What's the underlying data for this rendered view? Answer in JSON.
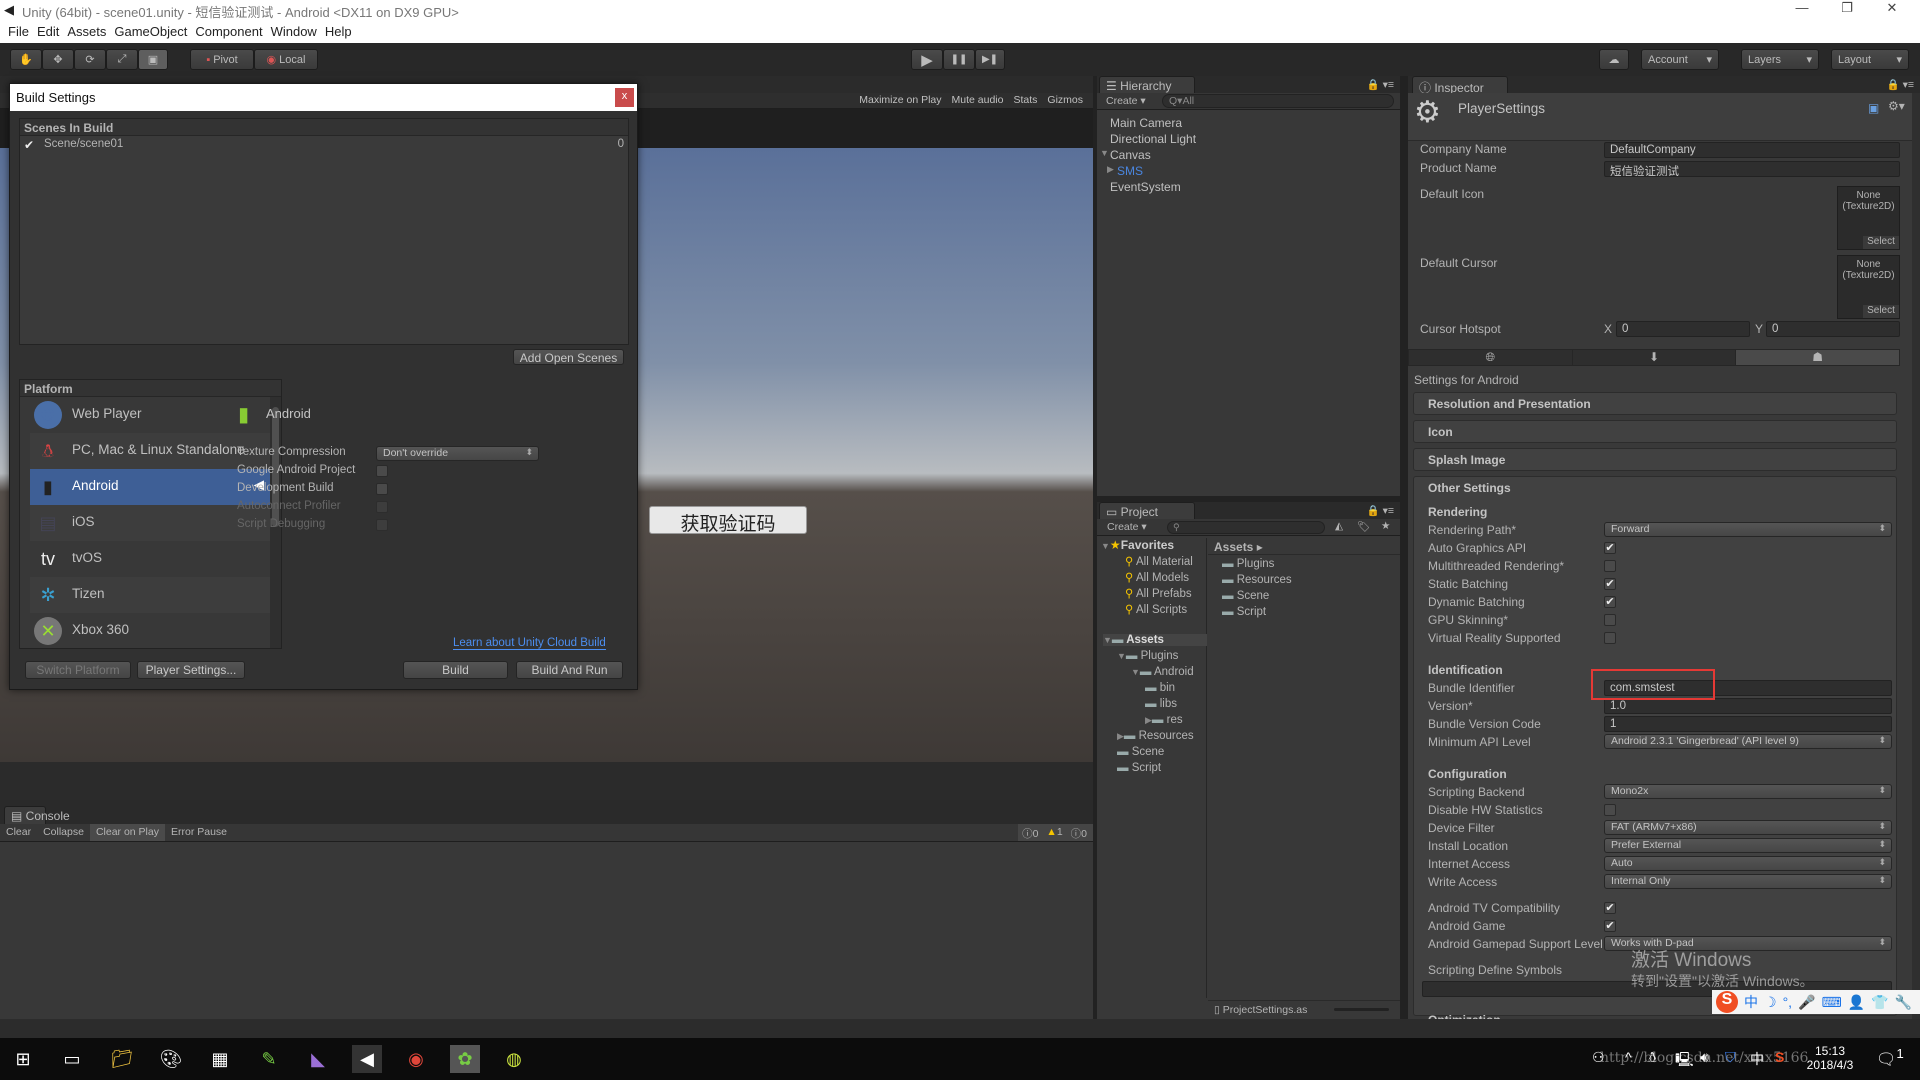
{
  "window": {
    "title": "Unity (64bit) - scene01.unity - 短信验证测试 - Android <DX11 on DX9 GPU>",
    "minimize": "—",
    "maximize": "❐",
    "close": "✕"
  },
  "menu": [
    "File",
    "Edit",
    "Assets",
    "GameObject",
    "Component",
    "Window",
    "Help"
  ],
  "toolbar": {
    "tools": [
      "hand-icon",
      "move-icon",
      "rotate-icon",
      "scale-icon",
      "rect-icon"
    ],
    "active_tool": "rect-icon",
    "pivot": "Pivot",
    "local": "Local",
    "play": "▶",
    "pause": "❚❚",
    "step": "▶❚",
    "account": "Account",
    "layers": "Layers",
    "layout": "Layout"
  },
  "game": {
    "toolbar": [
      "Maximize on Play",
      "Mute audio",
      "Stats",
      "Gizmos"
    ],
    "button_text": "获取验证码",
    "colors": {
      "sky": "#5a7099",
      "horizon": "#b8bcc0",
      "ground": "#564f4a"
    }
  },
  "build_settings": {
    "title": "Build Settings",
    "close": "x",
    "scenes_header": "Scenes In Build",
    "scenes": [
      {
        "name": "Scene/scene01",
        "index": "0",
        "checked": true
      }
    ],
    "add_open_scenes": "Add Open Scenes",
    "platform_header": "Platform",
    "platforms": [
      {
        "name": "Web Player",
        "icon": "globe-icon",
        "color": "#4a6fa8"
      },
      {
        "name": "PC, Mac & Linux Standalone",
        "icon": "standalone-icon",
        "color": "#d44"
      },
      {
        "name": "Android",
        "icon": "android-icon",
        "color": "#222",
        "selected": true,
        "active": true
      },
      {
        "name": "iOS",
        "icon": "ios-icon",
        "color": "#445"
      },
      {
        "name": "tvOS",
        "icon": "tvos-icon",
        "color": "#eee"
      },
      {
        "name": "Tizen",
        "icon": "tizen-icon",
        "color": "#3aa0d0"
      },
      {
        "name": "Xbox 360",
        "icon": "xbox-icon",
        "color": "#777"
      }
    ],
    "selected_platform": "Android",
    "options": [
      {
        "label": "Texture Compression",
        "type": "dropdown",
        "value": "Don't override"
      },
      {
        "label": "Google Android Project",
        "type": "check",
        "checked": false
      },
      {
        "label": "Development Build",
        "type": "check",
        "checked": false
      },
      {
        "label": "Autoconnect Profiler",
        "type": "check",
        "checked": false,
        "disabled": true
      },
      {
        "label": "Script Debugging",
        "type": "check",
        "checked": false,
        "disabled": true
      }
    ],
    "cloud_link": "Learn about Unity Cloud Build",
    "switch_platform": "Switch Platform",
    "player_settings": "Player Settings...",
    "build": "Build",
    "build_and_run": "Build And Run"
  },
  "hierarchy": {
    "tab": "Hierarchy",
    "create": "Create ▾",
    "search_placeholder": "Q▾All",
    "items": [
      {
        "name": "Main Camera"
      },
      {
        "name": "Directional Light"
      },
      {
        "name": "Canvas",
        "expanded": true
      },
      {
        "name": "SMS",
        "child": true,
        "collapsed": true
      },
      {
        "name": "EventSystem"
      }
    ]
  },
  "project": {
    "tab": "Project",
    "create": "Create ▾",
    "favorites_label": "Favorites",
    "favorites": [
      "All Material",
      "All Models",
      "All Prefabs",
      "All Scripts"
    ],
    "tree": [
      {
        "name": "Assets",
        "depth": 0,
        "bold": true
      },
      {
        "name": "Plugins",
        "depth": 1
      },
      {
        "name": "Android",
        "depth": 2
      },
      {
        "name": "bin",
        "depth": 3
      },
      {
        "name": "libs",
        "depth": 3
      },
      {
        "name": "res",
        "depth": 3
      },
      {
        "name": "Resources",
        "depth": 1
      },
      {
        "name": "Scene",
        "depth": 1
      },
      {
        "name": "Script",
        "depth": 1
      }
    ],
    "breadcrumb": "Assets ▸",
    "contents": [
      "Plugins",
      "Resources",
      "Scene",
      "Script"
    ],
    "status_file": "ProjectSettings.as"
  },
  "console": {
    "tab": "Console",
    "buttons": [
      "Clear",
      "Collapse",
      "Clear on Play",
      "Error Pause"
    ],
    "active_button": "Clear on Play",
    "counts": {
      "info": "0",
      "warnings": "1",
      "errors": "0"
    }
  },
  "inspector": {
    "tab": "Inspector",
    "object": "PlayerSettings",
    "company_label": "Company Name",
    "company": "DefaultCompany",
    "product_label": "Product Name",
    "product": "短信验证测试",
    "default_icon_label": "Default Icon",
    "default_cursor_label": "Default Cursor",
    "texture_none": "None",
    "texture_type": "(Texture2D)",
    "select": "Select",
    "hotspot_label": "Cursor Hotspot",
    "hotspot_x_label": "X",
    "hotspot_x": "0",
    "hotspot_y_label": "Y",
    "hotspot_y": "0",
    "platform_tabs": [
      "globe-icon",
      "download-icon",
      "android-icon"
    ],
    "active_platform_tab": "android-icon",
    "settings_for": "Settings for Android",
    "foldouts": [
      "Resolution and Presentation",
      "Icon",
      "Splash Image",
      "Other Settings"
    ],
    "groups": [
      {
        "header": "Rendering",
        "blocks": [
          [
            {
              "label": "Rendering Path*",
              "type": "dropdown",
              "value": "Forward"
            },
            {
              "label": "Auto Graphics API",
              "type": "check",
              "checked": true
            },
            {
              "label": "Multithreaded Rendering*",
              "type": "check",
              "checked": false
            },
            {
              "label": "Static Batching",
              "type": "check",
              "checked": true
            },
            {
              "label": "Dynamic Batching",
              "type": "check",
              "checked": true
            },
            {
              "label": "GPU Skinning*",
              "type": "check",
              "checked": false
            },
            {
              "label": "Virtual Reality Supported",
              "type": "check",
              "checked": false
            }
          ]
        ]
      },
      {
        "header": "Identification",
        "blocks": [
          [
            {
              "label": "Bundle Identifier",
              "type": "text",
              "value": "com.smstest",
              "highlighted": true
            },
            {
              "label": "Version*",
              "type": "text",
              "value": "1.0"
            },
            {
              "label": "Bundle Version Code",
              "type": "text",
              "value": "1"
            },
            {
              "label": "Minimum API Level",
              "type": "dropdown",
              "value": "Android 2.3.1 'Gingerbread' (API level 9)"
            }
          ]
        ]
      },
      {
        "header": "Configuration",
        "blocks": [
          [
            {
              "label": "Scripting Backend",
              "type": "dropdown",
              "value": "Mono2x"
            },
            {
              "label": "Disable HW Statistics",
              "type": "check",
              "checked": false
            },
            {
              "label": "Device Filter",
              "type": "dropdown",
              "value": "FAT (ARMv7+x86)"
            },
            {
              "label": "Install Location",
              "type": "dropdown",
              "value": "Prefer External"
            },
            {
              "label": "Internet Access",
              "type": "dropdown",
              "value": "Auto"
            },
            {
              "label": "Write Access",
              "type": "dropdown",
              "value": "Internal Only"
            }
          ],
          [
            {
              "label": "Android TV Compatibility",
              "type": "check",
              "checked": true
            },
            {
              "label": "Android Game",
              "type": "check",
              "checked": true
            },
            {
              "label": "Android Gamepad Support Level",
              "type": "dropdown",
              "value": "Works with D-pad"
            }
          ],
          [
            {
              "label": "Scripting Define Symbols",
              "type": "label"
            },
            {
              "label": "",
              "type": "widetext",
              "value": ""
            }
          ]
        ]
      },
      {
        "header": "Optimization",
        "blocks": []
      }
    ],
    "highlight_color": "#e53935"
  },
  "watermark": {
    "activate": "激活 Windows",
    "activate_sub": "转到\"设置\"以激活 Windows。",
    "blog": "http://blog.csdn.net/xmx5166"
  },
  "ime": {
    "logo": "S",
    "items": [
      "中",
      "☽",
      "°,",
      "🎤",
      "⌨",
      "👤",
      "👕",
      "🔧"
    ]
  },
  "taskbar": {
    "time": "15:13",
    "date": "2018/4/3",
    "notifications": "1",
    "apps": [
      "windows-start-icon",
      "task-view-icon",
      "file-explorer-icon",
      "paint-icon",
      "calculator-icon",
      "notepad-icon",
      "visual-studio-icon",
      "unity-icon",
      "chrome-icon",
      "game-icon",
      "android-sdk-icon"
    ],
    "tray": [
      "people-icon",
      "chevron-up-icon",
      "qq-icon",
      "network-icon",
      "volume-icon",
      "security-icon",
      "中",
      "sogou-icon"
    ]
  }
}
